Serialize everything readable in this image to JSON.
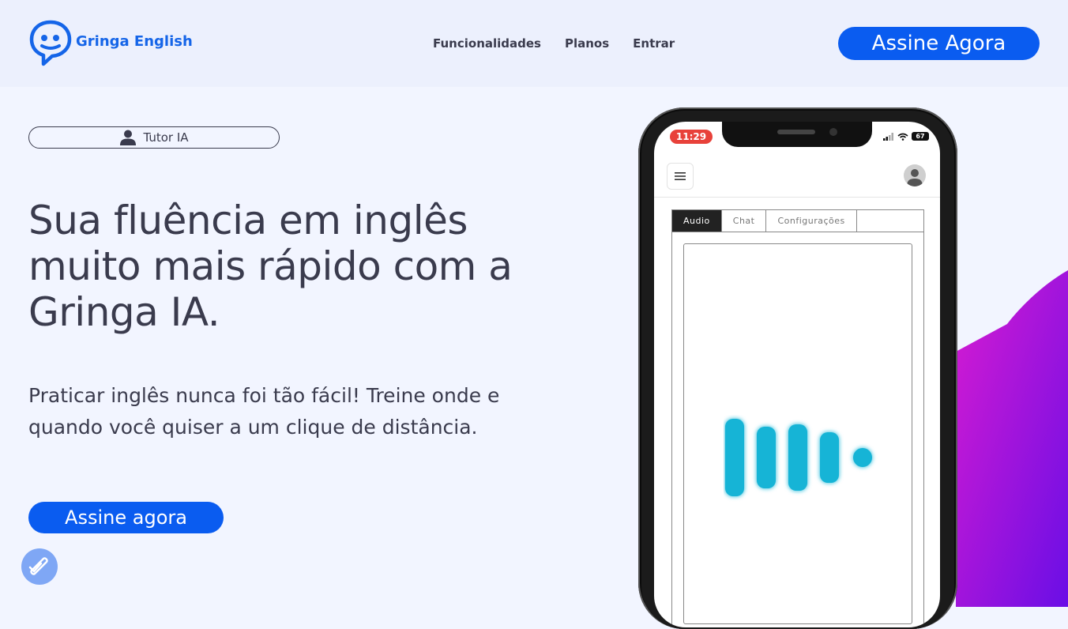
{
  "brand": {
    "name": "Gringa English",
    "color": "#1565e8"
  },
  "nav": {
    "items": [
      "Funcionalidades",
      "Planos",
      "Entrar"
    ]
  },
  "header": {
    "cta_label": "Assine Agora"
  },
  "hero": {
    "badge_label": "Tutor IA",
    "title": "Sua fluência em inglês muito mais rápido com a Gringa IA.",
    "subtitle": "Praticar inglês nunca foi tão fácil! Treine onde e quando você quiser a um clique de distância.",
    "cta_label": "Assine agora"
  },
  "phone": {
    "time": "11:29",
    "battery": "67",
    "tabs": [
      "Audio",
      "Chat",
      "Configurações"
    ],
    "active_tab": "Audio"
  },
  "colors": {
    "accent": "#0a5cf0",
    "text": "#3a3b4d",
    "background": "#f2f5ff",
    "wave": "#12b4d6"
  },
  "icons": [
    "chat-bubble-logo-icon",
    "user-icon",
    "menu-icon",
    "avatar-icon",
    "signal-icon",
    "wifi-icon",
    "battery-icon",
    "audio-wave-icon",
    "badge-check-icon"
  ]
}
